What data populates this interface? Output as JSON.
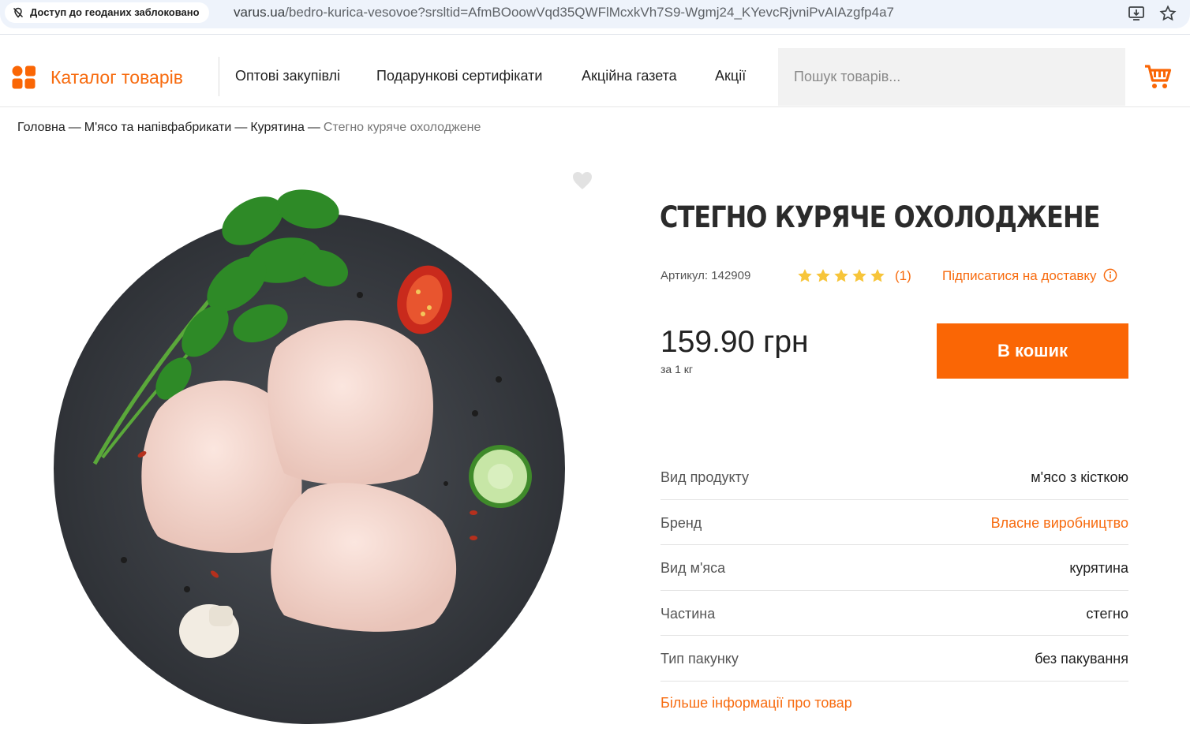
{
  "browser": {
    "geo_chip": "Доступ до геоданих заблоковано",
    "url_host": "varus.ua",
    "url_rest": "/bedro-kurica-vesovoe?srsltid=AfmBOoowVqd35QWFlMcxkVh7S9-Wgmj24_KYevcRjvniPvAIAzgfp4a7"
  },
  "header": {
    "catalog_label": "Каталог товарів",
    "nav": [
      "Оптові закупівлі",
      "Подарункові сертифікати",
      "Акційна газета",
      "Акції"
    ],
    "search_placeholder": "Пошук товарів..."
  },
  "breadcrumb": [
    "Головна",
    "М'ясо та напівфабрикати",
    "Курятина",
    "Стегно куряче охолоджене"
  ],
  "breadcrumb_sep": "—",
  "product": {
    "title": "СТЕГНО КУРЯЧЕ ОХОЛОДЖЕНЕ",
    "sku": "Артикул: 142909",
    "rating": 5,
    "reviews": "(1)",
    "subscribe": "Підписатися на доставку",
    "price": "159.90 грн",
    "per_unit": "за 1 кг",
    "buy_label": "В кошик",
    "specs": [
      {
        "label": "Вид продукту",
        "value": "м'ясо з кісткою",
        "link": false
      },
      {
        "label": "Бренд",
        "value": "Власне виробництво",
        "link": true
      },
      {
        "label": "Вид м'яса",
        "value": "курятина",
        "link": false
      },
      {
        "label": "Частина",
        "value": "стегно",
        "link": false
      },
      {
        "label": "Тип пакунку",
        "value": "без пакування",
        "link": false
      }
    ],
    "more_info": "Більше інформації про товар"
  },
  "colors": {
    "accent": "#f76b0f",
    "button": "#fa6605",
    "star": "#f7c53a"
  },
  "icons": [
    "location-off-icon",
    "install-app-icon",
    "bookmark-star-icon",
    "catalog-grid-icon",
    "cart-icon",
    "heart-icon",
    "star-icon",
    "info-icon"
  ]
}
